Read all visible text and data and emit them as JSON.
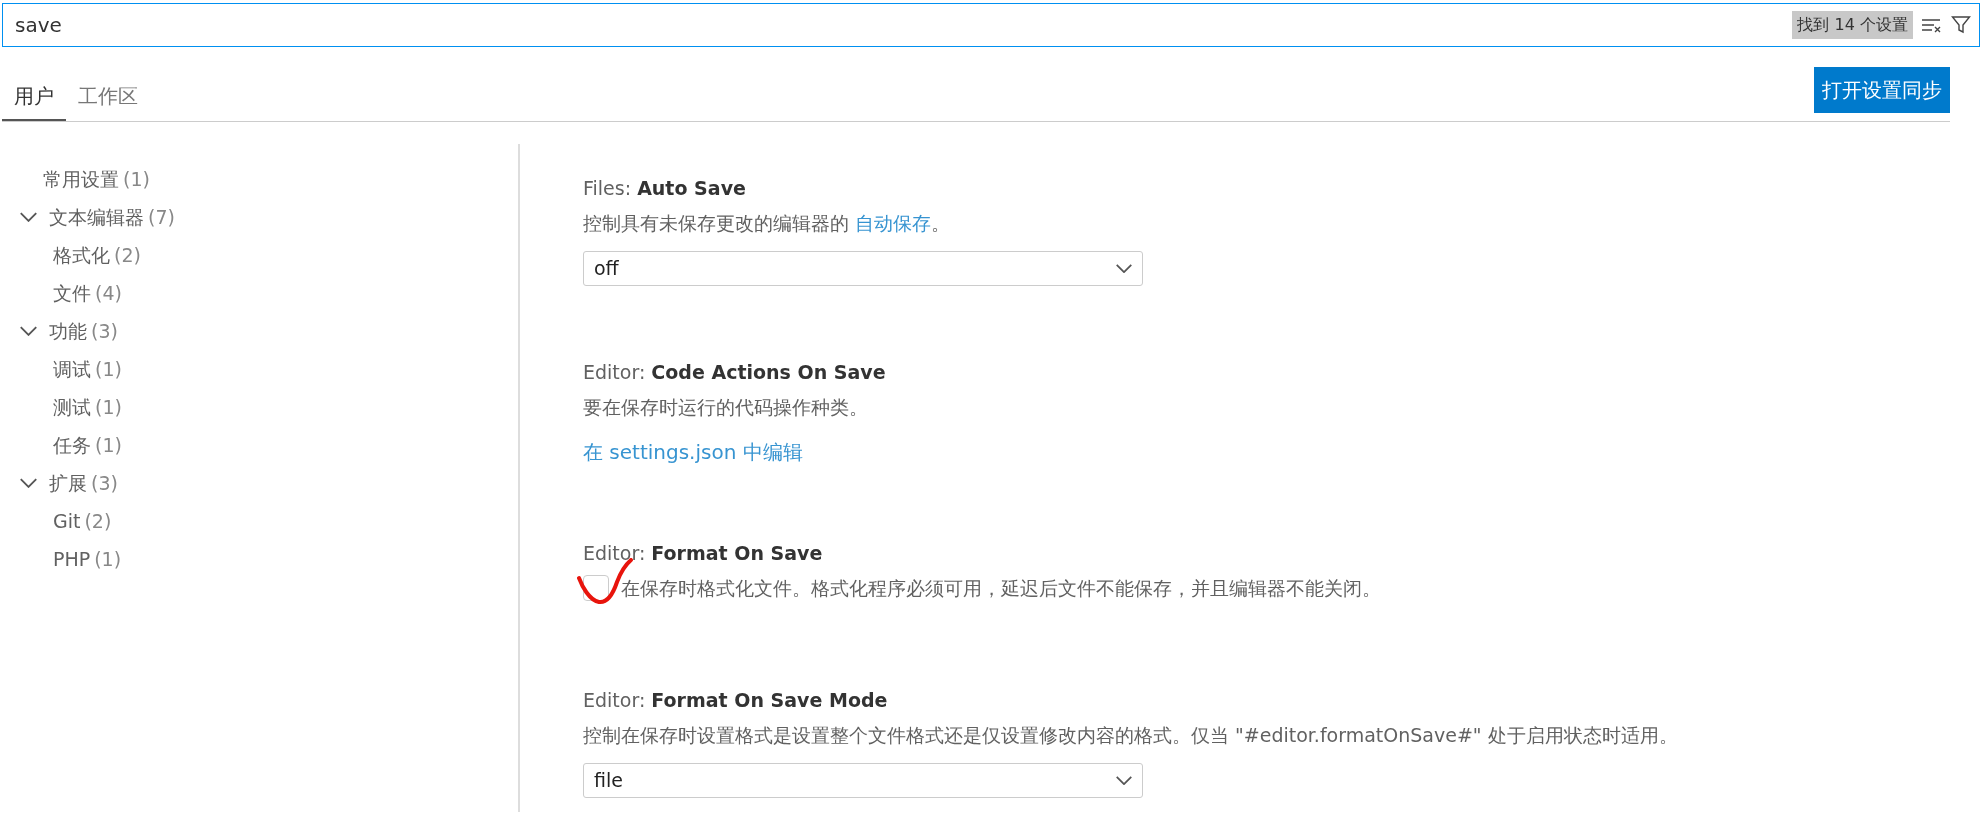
{
  "search": {
    "value": "save",
    "result_count": "找到 14 个设置"
  },
  "tabs": [
    {
      "label": "用户",
      "selected": true
    },
    {
      "label": "工作区",
      "selected": false
    }
  ],
  "sync_button": "打开设置同步",
  "sidebar": {
    "items": [
      {
        "label": "常用设置",
        "count": "(1)"
      },
      {
        "label": "文本编辑器",
        "count": "(7)",
        "expanded": true,
        "children": [
          {
            "label": "格式化",
            "count": "(2)"
          },
          {
            "label": "文件",
            "count": "(4)"
          }
        ]
      },
      {
        "label": "功能",
        "count": "(3)",
        "expanded": true,
        "children": [
          {
            "label": "调试",
            "count": "(1)"
          },
          {
            "label": "测试",
            "count": "(1)"
          },
          {
            "label": "任务",
            "count": "(1)"
          }
        ]
      },
      {
        "label": "扩展",
        "count": "(3)",
        "expanded": true,
        "children": [
          {
            "label": "Git",
            "count": "(2)"
          },
          {
            "label": "PHP",
            "count": "(1)"
          }
        ]
      }
    ]
  },
  "settings": [
    {
      "kind": "select",
      "category": "Files: ",
      "name": "Auto Save",
      "description": "控制具有未保存更改的编辑器的 ",
      "description_link": "自动保存",
      "description_end": "。",
      "value": "off"
    },
    {
      "kind": "link",
      "category": "Editor: ",
      "name": "Code Actions On Save",
      "description": "要在保存时运行的代码操作种类。",
      "link": "在 settings.json 中编辑"
    },
    {
      "kind": "checkbox",
      "category": "Editor: ",
      "name": "Format On Save",
      "description": "在保存时格式化文件。格式化程序必须可用，延迟后文件不能保存，并且编辑器不能关闭。",
      "checked": false
    },
    {
      "kind": "select",
      "category": "Editor: ",
      "name": "Format On Save Mode",
      "description": "控制在保存时设置格式是设置整个文件格式还是仅设置修改内容的格式。仅当 \"#editor.formatOnSave#\" 处于启用状态时适用。",
      "value": "file"
    }
  ]
}
